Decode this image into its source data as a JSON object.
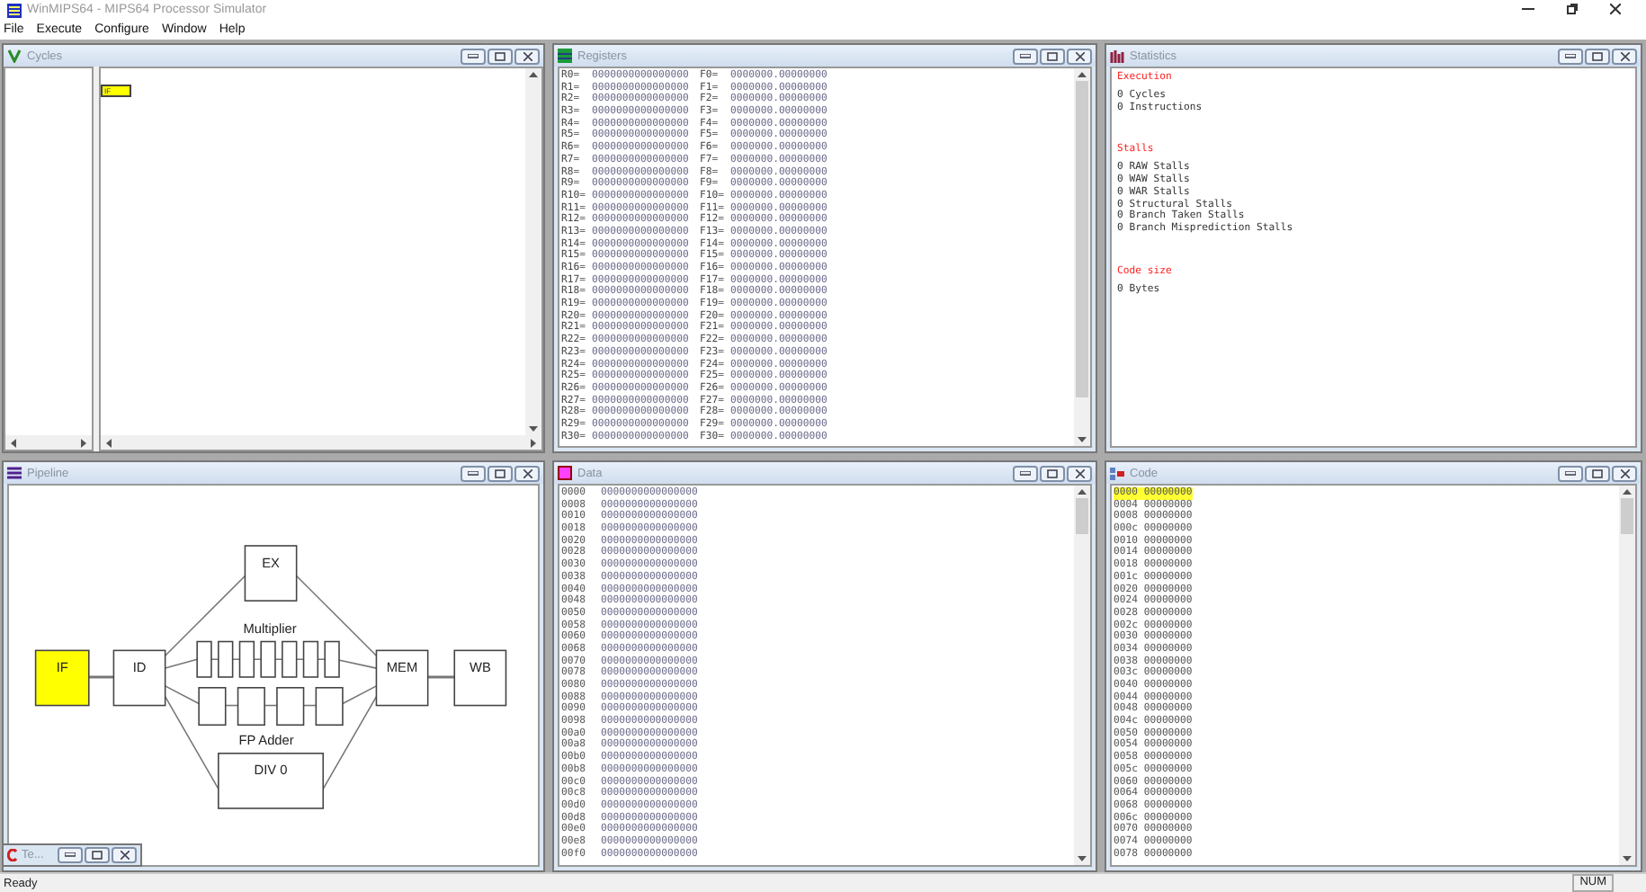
{
  "window": {
    "title": "WinMIPS64 - MIPS64 Processor Simulator"
  },
  "menu": [
    "File",
    "Execute",
    "Configure",
    "Window",
    "Help"
  ],
  "cycles": {
    "title": "Cycles",
    "stage_cell": "IF"
  },
  "registers": {
    "title": "Registers",
    "rows": [
      {
        "r": "R0=",
        "rv": "0000000000000000",
        "f": "F0=",
        "fv": "0000000.00000000"
      },
      {
        "r": "R1=",
        "rv": "0000000000000000",
        "f": "F1=",
        "fv": "0000000.00000000"
      },
      {
        "r": "R2=",
        "rv": "0000000000000000",
        "f": "F2=",
        "fv": "0000000.00000000"
      },
      {
        "r": "R3=",
        "rv": "0000000000000000",
        "f": "F3=",
        "fv": "0000000.00000000"
      },
      {
        "r": "R4=",
        "rv": "0000000000000000",
        "f": "F4=",
        "fv": "0000000.00000000"
      },
      {
        "r": "R5=",
        "rv": "0000000000000000",
        "f": "F5=",
        "fv": "0000000.00000000"
      },
      {
        "r": "R6=",
        "rv": "0000000000000000",
        "f": "F6=",
        "fv": "0000000.00000000"
      },
      {
        "r": "R7=",
        "rv": "0000000000000000",
        "f": "F7=",
        "fv": "0000000.00000000"
      },
      {
        "r": "R8=",
        "rv": "0000000000000000",
        "f": "F8=",
        "fv": "0000000.00000000"
      },
      {
        "r": "R9=",
        "rv": "0000000000000000",
        "f": "F9=",
        "fv": "0000000.00000000"
      },
      {
        "r": "R10=",
        "rv": "0000000000000000",
        "f": "F10=",
        "fv": "0000000.00000000"
      },
      {
        "r": "R11=",
        "rv": "0000000000000000",
        "f": "F11=",
        "fv": "0000000.00000000"
      },
      {
        "r": "R12=",
        "rv": "0000000000000000",
        "f": "F12=",
        "fv": "0000000.00000000"
      },
      {
        "r": "R13=",
        "rv": "0000000000000000",
        "f": "F13=",
        "fv": "0000000.00000000"
      },
      {
        "r": "R14=",
        "rv": "0000000000000000",
        "f": "F14=",
        "fv": "0000000.00000000"
      },
      {
        "r": "R15=",
        "rv": "0000000000000000",
        "f": "F15=",
        "fv": "0000000.00000000"
      },
      {
        "r": "R16=",
        "rv": "0000000000000000",
        "f": "F16=",
        "fv": "0000000.00000000"
      },
      {
        "r": "R17=",
        "rv": "0000000000000000",
        "f": "F17=",
        "fv": "0000000.00000000"
      },
      {
        "r": "R18=",
        "rv": "0000000000000000",
        "f": "F18=",
        "fv": "0000000.00000000"
      },
      {
        "r": "R19=",
        "rv": "0000000000000000",
        "f": "F19=",
        "fv": "0000000.00000000"
      },
      {
        "r": "R20=",
        "rv": "0000000000000000",
        "f": "F20=",
        "fv": "0000000.00000000"
      },
      {
        "r": "R21=",
        "rv": "0000000000000000",
        "f": "F21=",
        "fv": "0000000.00000000"
      },
      {
        "r": "R22=",
        "rv": "0000000000000000",
        "f": "F22=",
        "fv": "0000000.00000000"
      },
      {
        "r": "R23=",
        "rv": "0000000000000000",
        "f": "F23=",
        "fv": "0000000.00000000"
      },
      {
        "r": "R24=",
        "rv": "0000000000000000",
        "f": "F24=",
        "fv": "0000000.00000000"
      },
      {
        "r": "R25=",
        "rv": "0000000000000000",
        "f": "F25=",
        "fv": "0000000.00000000"
      },
      {
        "r": "R26=",
        "rv": "0000000000000000",
        "f": "F26=",
        "fv": "0000000.00000000"
      },
      {
        "r": "R27=",
        "rv": "0000000000000000",
        "f": "F27=",
        "fv": "0000000.00000000"
      },
      {
        "r": "R28=",
        "rv": "0000000000000000",
        "f": "F28=",
        "fv": "0000000.00000000"
      },
      {
        "r": "R29=",
        "rv": "0000000000000000",
        "f": "F29=",
        "fv": "0000000.00000000"
      },
      {
        "r": "R30=",
        "rv": "0000000000000000",
        "f": "F30=",
        "fv": "0000000.00000000"
      }
    ]
  },
  "statistics": {
    "title": "Statistics",
    "sections": [
      {
        "heading": "Execution",
        "items": [
          "0 Cycles",
          "0 Instructions"
        ]
      },
      {
        "heading": "Stalls",
        "items": [
          "0 RAW Stalls",
          "0 WAW Stalls",
          "0 WAR Stalls",
          "0 Structural Stalls",
          "0 Branch Taken Stalls",
          "0 Branch Misprediction Stalls"
        ]
      },
      {
        "heading": "Code size",
        "items": [
          "0 Bytes"
        ]
      }
    ]
  },
  "pipeline": {
    "title": "Pipeline",
    "stages": [
      {
        "kind": "if",
        "label": "IF",
        "active": true
      },
      {
        "kind": "id",
        "label": "ID",
        "active": false
      },
      {
        "kind": "ex",
        "label": "EX",
        "active": false
      },
      {
        "kind": "mem",
        "label": "MEM",
        "active": false
      },
      {
        "kind": "wb",
        "label": "WB",
        "active": false
      },
      {
        "kind": "div",
        "label": "DIV  0",
        "active": false
      }
    ],
    "multiplier_label": "Multiplier",
    "adder_label": "FP Adder"
  },
  "minimized_window": {
    "title": "Te..."
  },
  "data": {
    "title": "Data",
    "rows": [
      [
        "0000",
        "0000000000000000"
      ],
      [
        "0008",
        "0000000000000000"
      ],
      [
        "0010",
        "0000000000000000"
      ],
      [
        "0018",
        "0000000000000000"
      ],
      [
        "0020",
        "0000000000000000"
      ],
      [
        "0028",
        "0000000000000000"
      ],
      [
        "0030",
        "0000000000000000"
      ],
      [
        "0038",
        "0000000000000000"
      ],
      [
        "0040",
        "0000000000000000"
      ],
      [
        "0048",
        "0000000000000000"
      ],
      [
        "0050",
        "0000000000000000"
      ],
      [
        "0058",
        "0000000000000000"
      ],
      [
        "0060",
        "0000000000000000"
      ],
      [
        "0068",
        "0000000000000000"
      ],
      [
        "0070",
        "0000000000000000"
      ],
      [
        "0078",
        "0000000000000000"
      ],
      [
        "0080",
        "0000000000000000"
      ],
      [
        "0088",
        "0000000000000000"
      ],
      [
        "0090",
        "0000000000000000"
      ],
      [
        "0098",
        "0000000000000000"
      ],
      [
        "00a0",
        "0000000000000000"
      ],
      [
        "00a8",
        "0000000000000000"
      ],
      [
        "00b0",
        "0000000000000000"
      ],
      [
        "00b8",
        "0000000000000000"
      ],
      [
        "00c0",
        "0000000000000000"
      ],
      [
        "00c8",
        "0000000000000000"
      ],
      [
        "00d0",
        "0000000000000000"
      ],
      [
        "00d8",
        "0000000000000000"
      ],
      [
        "00e0",
        "0000000000000000"
      ],
      [
        "00e8",
        "0000000000000000"
      ],
      [
        "00f0",
        "0000000000000000"
      ]
    ]
  },
  "code": {
    "title": "Code",
    "rows": [
      {
        "addr": "0000",
        "value": "00000000",
        "selected": true
      },
      {
        "addr": "0004",
        "value": "00000000",
        "selected": false
      },
      {
        "addr": "0008",
        "value": "00000000",
        "selected": false
      },
      {
        "addr": "000c",
        "value": "00000000",
        "selected": false
      },
      {
        "addr": "0010",
        "value": "00000000",
        "selected": false
      },
      {
        "addr": "0014",
        "value": "00000000",
        "selected": false
      },
      {
        "addr": "0018",
        "value": "00000000",
        "selected": false
      },
      {
        "addr": "001c",
        "value": "00000000",
        "selected": false
      },
      {
        "addr": "0020",
        "value": "00000000",
        "selected": false
      },
      {
        "addr": "0024",
        "value": "00000000",
        "selected": false
      },
      {
        "addr": "0028",
        "value": "00000000",
        "selected": false
      },
      {
        "addr": "002c",
        "value": "00000000",
        "selected": false
      },
      {
        "addr": "0030",
        "value": "00000000",
        "selected": false
      },
      {
        "addr": "0034",
        "value": "00000000",
        "selected": false
      },
      {
        "addr": "0038",
        "value": "00000000",
        "selected": false
      },
      {
        "addr": "003c",
        "value": "00000000",
        "selected": false
      },
      {
        "addr": "0040",
        "value": "00000000",
        "selected": false
      },
      {
        "addr": "0044",
        "value": "00000000",
        "selected": false
      },
      {
        "addr": "0048",
        "value": "00000000",
        "selected": false
      },
      {
        "addr": "004c",
        "value": "00000000",
        "selected": false
      },
      {
        "addr": "0050",
        "value": "00000000",
        "selected": false
      },
      {
        "addr": "0054",
        "value": "00000000",
        "selected": false
      },
      {
        "addr": "0058",
        "value": "00000000",
        "selected": false
      },
      {
        "addr": "005c",
        "value": "00000000",
        "selected": false
      },
      {
        "addr": "0060",
        "value": "00000000",
        "selected": false
      },
      {
        "addr": "0064",
        "value": "00000000",
        "selected": false
      },
      {
        "addr": "0068",
        "value": "00000000",
        "selected": false
      },
      {
        "addr": "006c",
        "value": "00000000",
        "selected": false
      },
      {
        "addr": "0070",
        "value": "00000000",
        "selected": false
      },
      {
        "addr": "0074",
        "value": "00000000",
        "selected": false
      },
      {
        "addr": "0078",
        "value": "00000000",
        "selected": false
      }
    ]
  },
  "status_bar": {
    "text": "Ready",
    "indicator": "NUM"
  }
}
